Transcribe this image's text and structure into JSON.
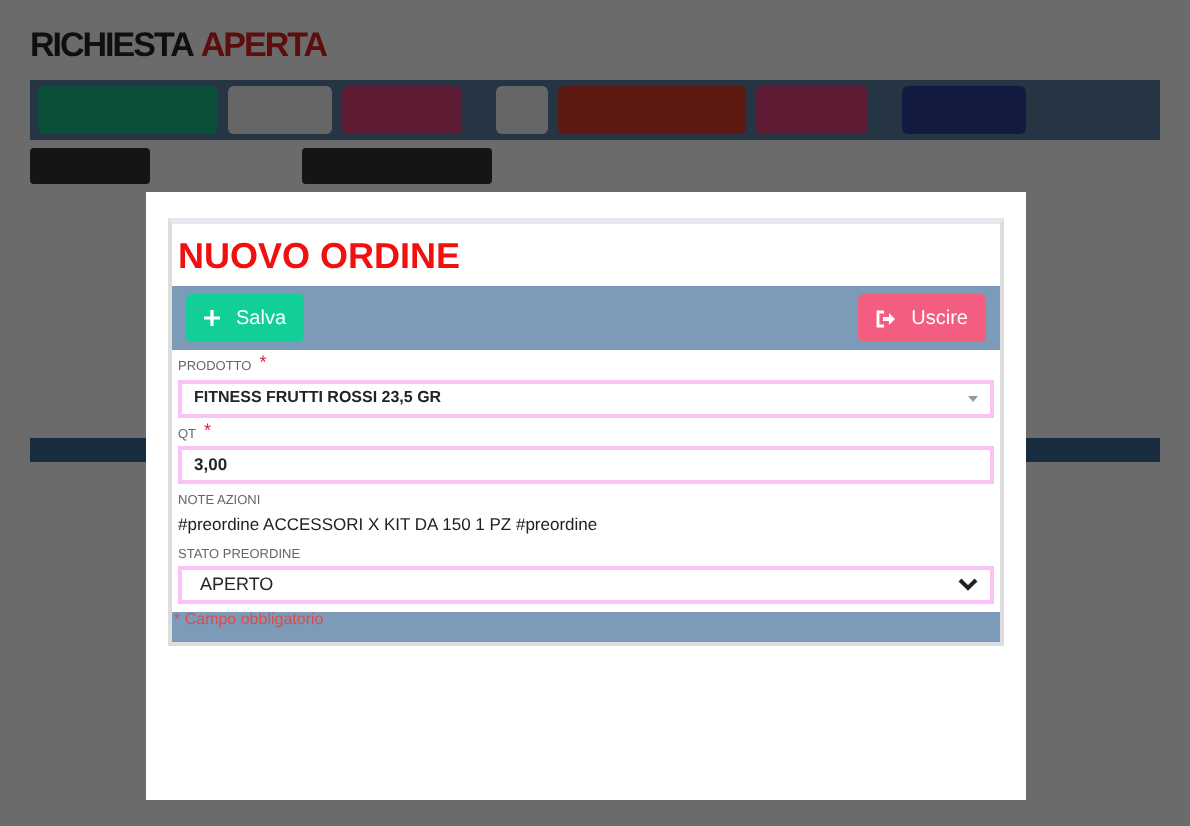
{
  "background": {
    "title": "RICHIESTA",
    "status": "APERTA"
  },
  "modal": {
    "title": "NUOVO ORDINE",
    "buttons": [
      {
        "kind": "save",
        "label": "Salva"
      },
      {
        "kind": "exit",
        "label": "Uscire"
      }
    ],
    "fields": [
      {
        "kind": "select",
        "label": "PRODOTTO",
        "required_mark": "*",
        "value": "FITNESS FRUTTI ROSSI 23,5 GR"
      },
      {
        "kind": "input",
        "label": "QT",
        "required_mark": "*",
        "value": "3,00"
      },
      {
        "kind": "note",
        "label": "NOTE AZIONI",
        "value": "#preordine ACCESSORI X KIT DA 150 1 PZ #preordine"
      },
      {
        "kind": "dropdown",
        "label": "STATO PREORDINE",
        "value": "APERTO"
      }
    ],
    "footnote": "* Campo obbligatorio"
  }
}
